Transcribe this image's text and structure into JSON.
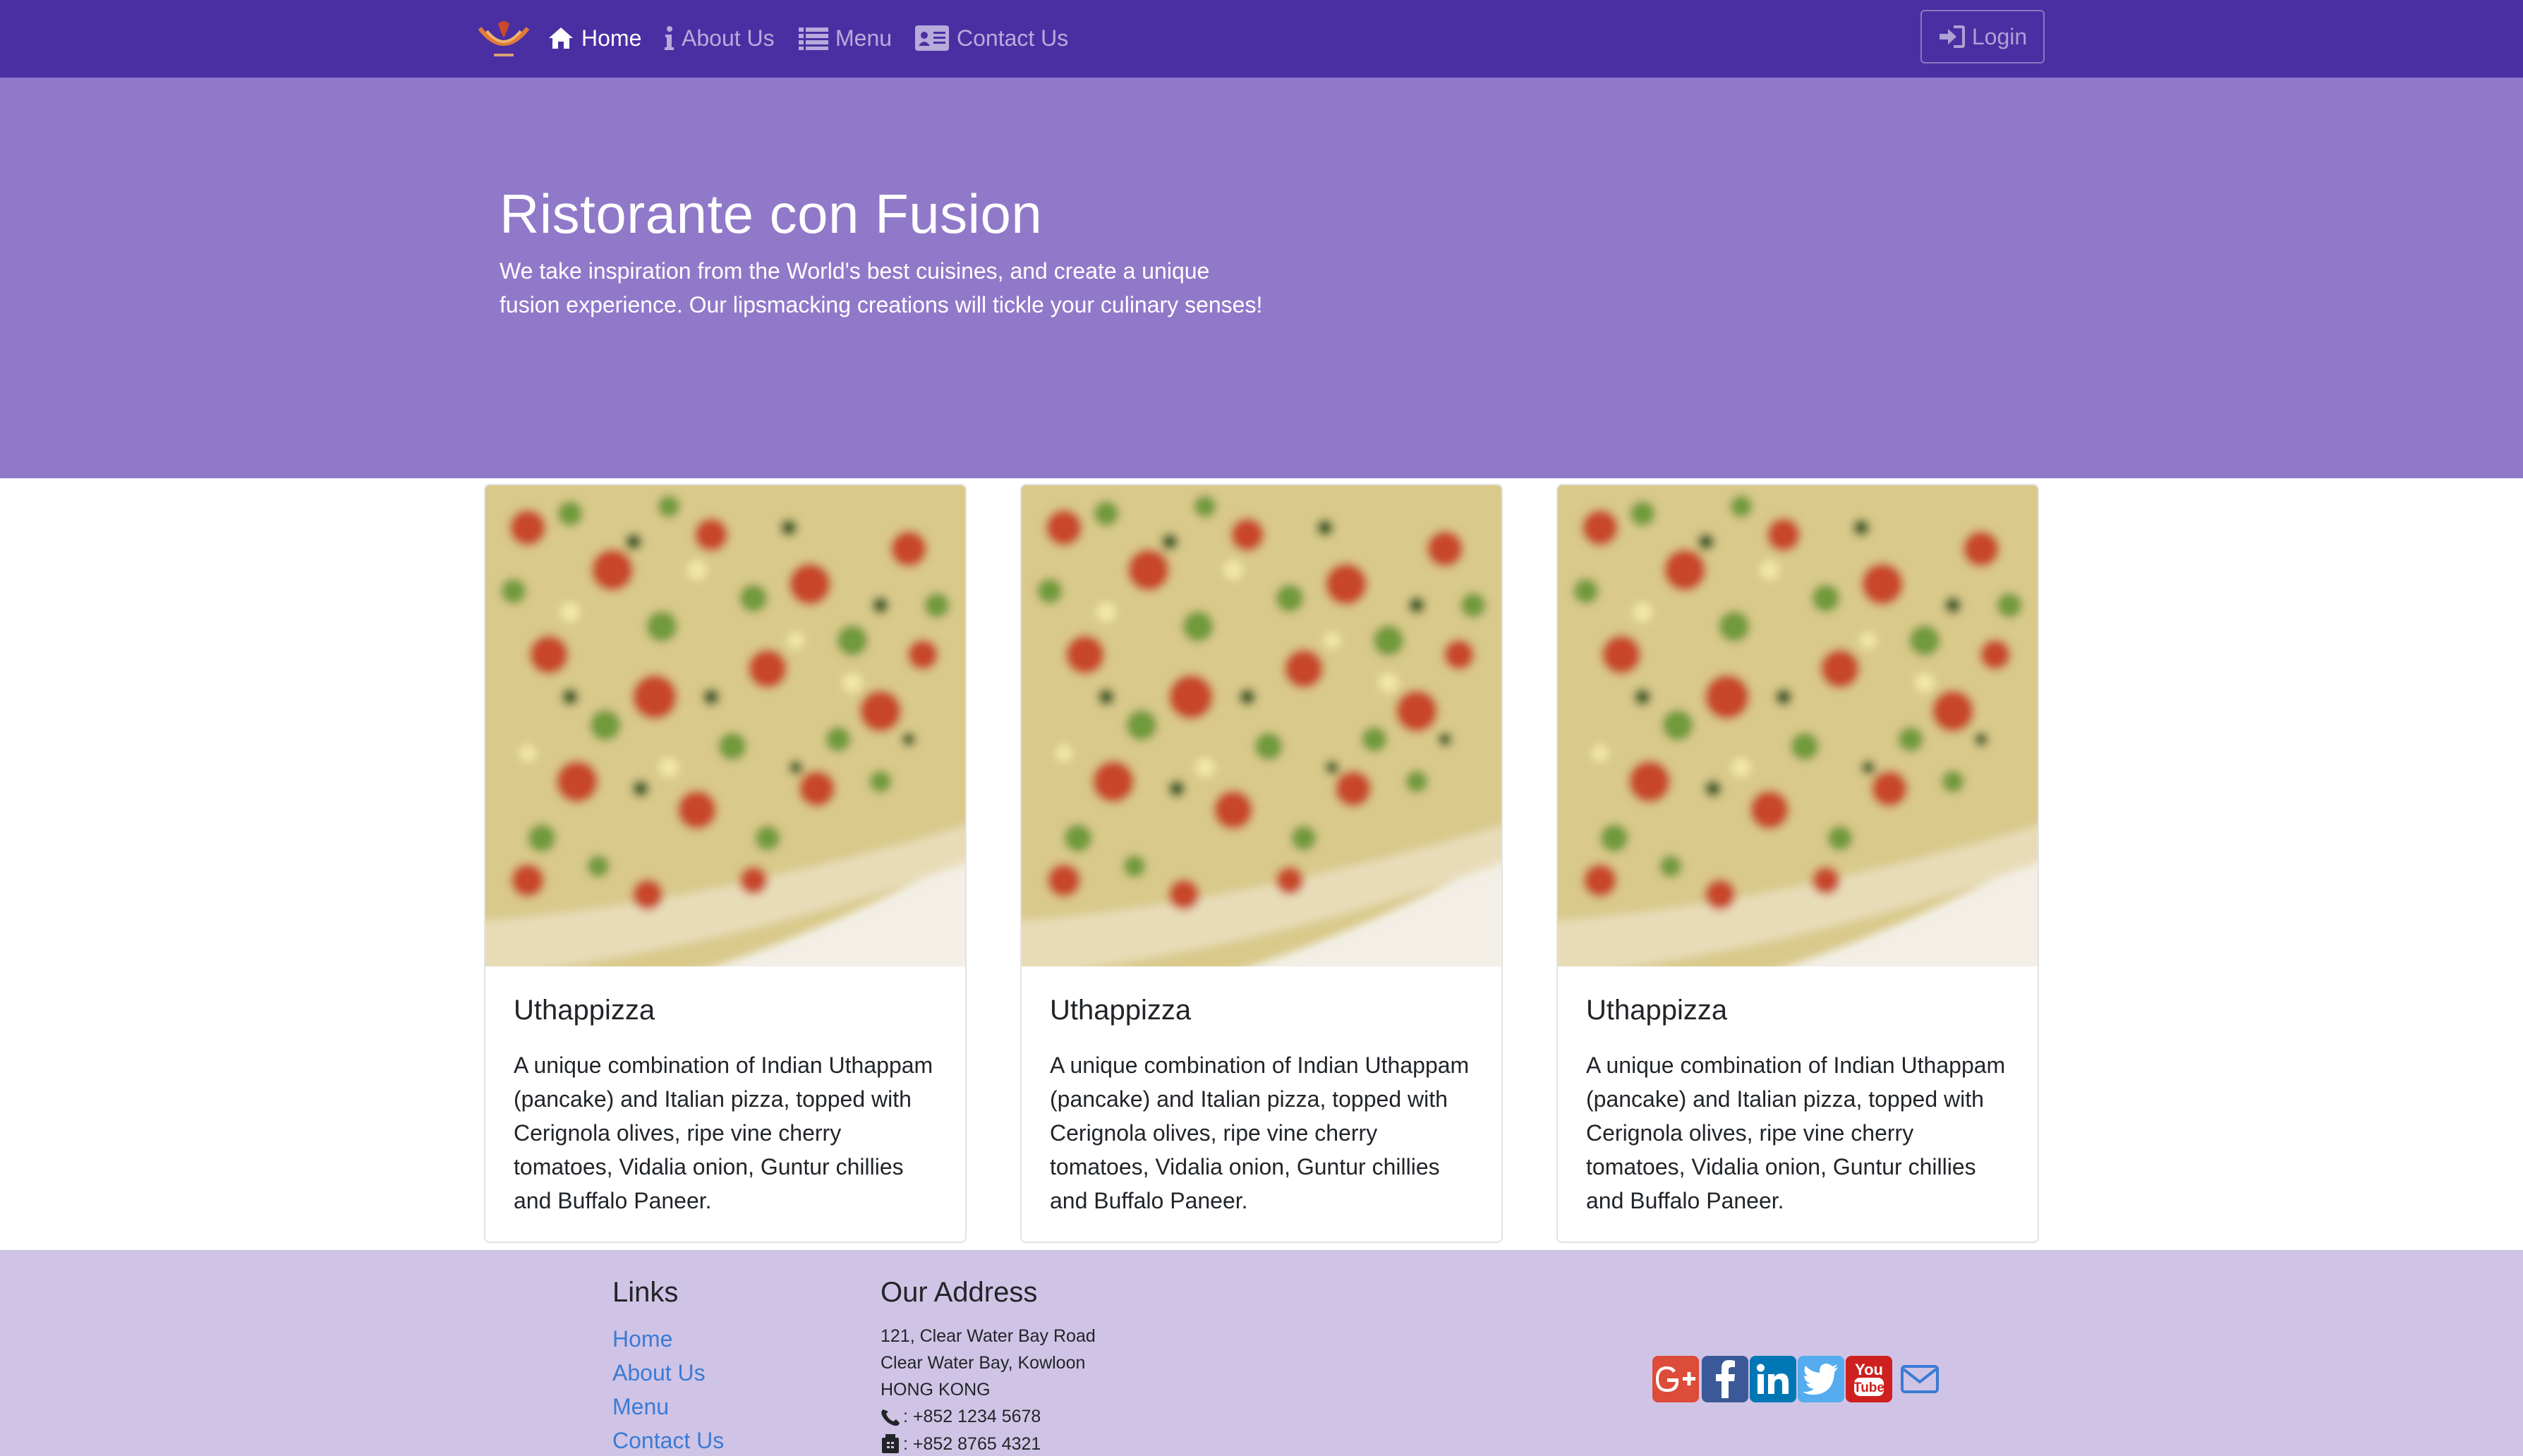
{
  "navbar": {
    "brand_icon": "logo",
    "items": [
      {
        "label": "Home",
        "icon": "home-icon",
        "active": true
      },
      {
        "label": "About Us",
        "icon": "info-icon",
        "active": false
      },
      {
        "label": "Menu",
        "icon": "list-icon",
        "active": false
      },
      {
        "label": "Contact Us",
        "icon": "address-card-icon",
        "active": false
      }
    ],
    "login_label": "Login",
    "login_icon": "sign-in-icon"
  },
  "jumbotron": {
    "title": "Ristorante con Fusion",
    "text": "We take inspiration from the World's best cuisines, and create a unique fusion experience. Our lipsmacking creations will tickle your culinary senses!"
  },
  "cards": [
    {
      "title": "Uthappizza",
      "text": "A unique combination of Indian Uthappam (pancake) and Italian pizza, topped with Cerignola olives, ripe vine cherry tomatoes, Vidalia onion, Guntur chillies and Buffalo Paneer."
    },
    {
      "title": "Uthappizza",
      "text": "A unique combination of Indian Uthappam (pancake) and Italian pizza, topped with Cerignola olives, ripe vine cherry tomatoes, Vidalia onion, Guntur chillies and Buffalo Paneer."
    },
    {
      "title": "Uthappizza",
      "text": "A unique combination of Indian Uthappam (pancake) and Italian pizza, topped with Cerignola olives, ripe vine cherry tomatoes, Vidalia onion, Guntur chillies and Buffalo Paneer."
    }
  ],
  "footer": {
    "links_heading": "Links",
    "links": [
      "Home",
      "About Us",
      "Menu",
      "Contact Us"
    ],
    "address_heading": "Our Address",
    "address": [
      "121, Clear Water Bay Road",
      "Clear Water Bay, Kowloon",
      "HONG KONG"
    ],
    "phone": ": +852 1234 5678",
    "fax": ": +852 8765 4321",
    "social": [
      "google-plus-icon",
      "facebook-icon",
      "linkedin-icon",
      "twitter-icon",
      "youtube-icon",
      "envelope-icon"
    ]
  },
  "colors": {
    "navbar": "#4a2fa3",
    "jumbotron": "#9079c9",
    "footer": "#d0c4e6",
    "link": "#3a7bd5"
  }
}
